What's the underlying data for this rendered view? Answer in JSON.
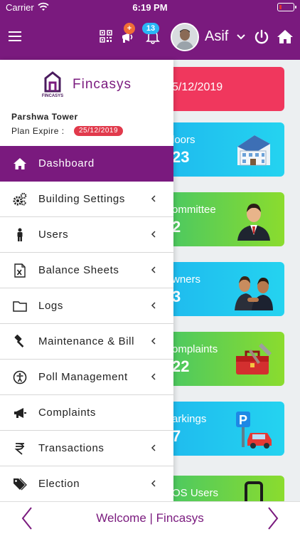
{
  "status_bar": {
    "carrier": "Carrier",
    "time": "6:19 PM"
  },
  "header": {
    "notification_badge_plus": "+",
    "notification_badge_count": "13",
    "user_name": "Asif"
  },
  "cards": [
    {
      "title": "5/12/2019",
      "value": ""
    },
    {
      "title": "loors",
      "value": "23"
    },
    {
      "title": "ommittee",
      "value": "2"
    },
    {
      "title": "wners",
      "value": "3"
    },
    {
      "title": "omplaints",
      "value": "22"
    },
    {
      "title": "arkings",
      "value": "7"
    },
    {
      "title": "OS Users",
      "value": ""
    }
  ],
  "drawer": {
    "brand_name": "Fincasys",
    "logo_text": "FINCASYS",
    "society_name": "Parshwa Tower",
    "plan_label": "Plan Expire :",
    "plan_expire_date": "25/12/2019",
    "menu": [
      {
        "label": "Dashboard",
        "icon": "home-icon",
        "active": true
      },
      {
        "label": "Building Settings",
        "icon": "gears-icon"
      },
      {
        "label": "Users",
        "icon": "person-icon"
      },
      {
        "label": "Balance Sheets",
        "icon": "excel-file-icon"
      },
      {
        "label": "Logs",
        "icon": "folder-icon"
      },
      {
        "label": "Maintenance & Bill",
        "icon": "gavel-icon"
      },
      {
        "label": "Poll Management",
        "icon": "accessibility-icon"
      },
      {
        "label": "Complaints",
        "icon": "bullhorn-icon"
      },
      {
        "label": "Transactions",
        "icon": "rupee-icon"
      },
      {
        "label": "Election",
        "icon": "tags-icon"
      }
    ]
  },
  "footer": {
    "text": "Welcome | Fincasys"
  },
  "colors": {
    "brand_purple": "#7a1a7e",
    "danger_red": "#f0375d",
    "badge_orange": "#f06d35",
    "badge_blue": "#29b6f6"
  }
}
